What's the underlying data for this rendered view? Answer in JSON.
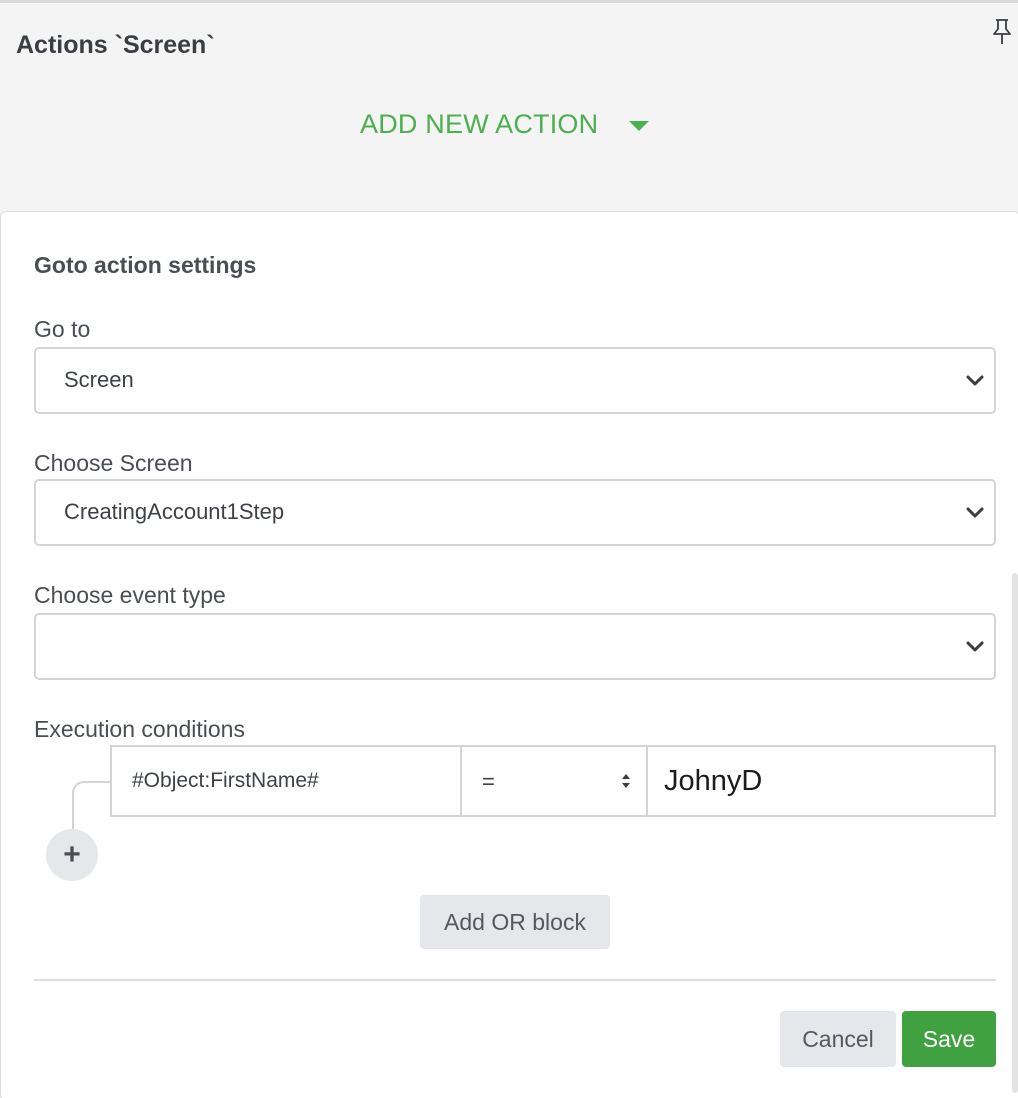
{
  "header": {
    "title": "Actions `Screen`",
    "add_action_label": "ADD NEW ACTION"
  },
  "form": {
    "section_title": "Goto action settings",
    "goto": {
      "label": "Go to",
      "value": "Screen"
    },
    "choose_screen": {
      "label": "Choose Screen",
      "value": "CreatingAccount1Step"
    },
    "event_type": {
      "label": "Choose event type",
      "value": ""
    },
    "conditions": {
      "label": "Execution conditions",
      "rows": [
        {
          "field": "#Object:FirstName#",
          "operator": "=",
          "value": "JohnyD"
        }
      ],
      "add_condition_label": "+",
      "add_or_block_label": "Add OR block"
    }
  },
  "footer": {
    "cancel_label": "Cancel",
    "save_label": "Save"
  },
  "colors": {
    "accent_green": "#4caf50",
    "save_green": "#3fa140"
  },
  "icons": [
    "pin-icon",
    "caret-down-icon",
    "chevron-down-icon",
    "up-down-icon",
    "plus-icon"
  ]
}
